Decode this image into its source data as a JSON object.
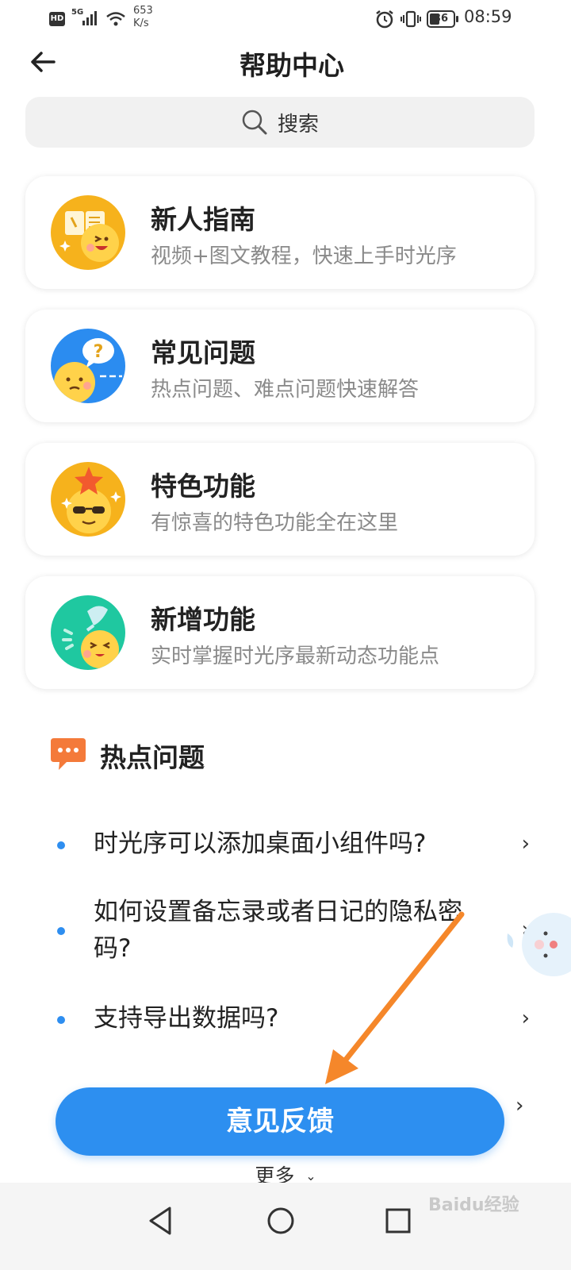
{
  "status_bar": {
    "hd": "HD",
    "network": "5G",
    "speed_value": "653",
    "speed_unit": "K/s",
    "battery": "36",
    "time": "08:59"
  },
  "header": {
    "title": "帮助中心"
  },
  "search": {
    "placeholder": "搜索"
  },
  "cards": [
    {
      "title": "新人指南",
      "subtitle": "视频+图文教程，快速上手时光序",
      "icon": "book-mascot-icon",
      "color": "#f6b21c"
    },
    {
      "title": "常见问题",
      "subtitle": "热点问题、难点问题快速解答",
      "icon": "question-mascot-icon",
      "color": "#2b8cf0"
    },
    {
      "title": "特色功能",
      "subtitle": "有惊喜的特色功能全在这里",
      "icon": "star-mascot-icon",
      "color": "#f6b21c"
    },
    {
      "title": "新增功能",
      "subtitle": "实时掌握时光序最新动态功能点",
      "icon": "sprout-mascot-icon",
      "color": "#1fc8a0"
    }
  ],
  "hot": {
    "title": "热点问题",
    "questions": [
      "时光序可以添加桌面小组件吗?",
      "如何设置备忘录或者日记的隐私密码?",
      "支持导出数据吗?"
    ]
  },
  "feedback_label": "意见反馈",
  "more_label": "更多",
  "watermark": "Baidu经验",
  "colors": {
    "accent": "#2d8ff0",
    "arrow": "#f5872a",
    "hot_icon": "#f47a3a"
  }
}
